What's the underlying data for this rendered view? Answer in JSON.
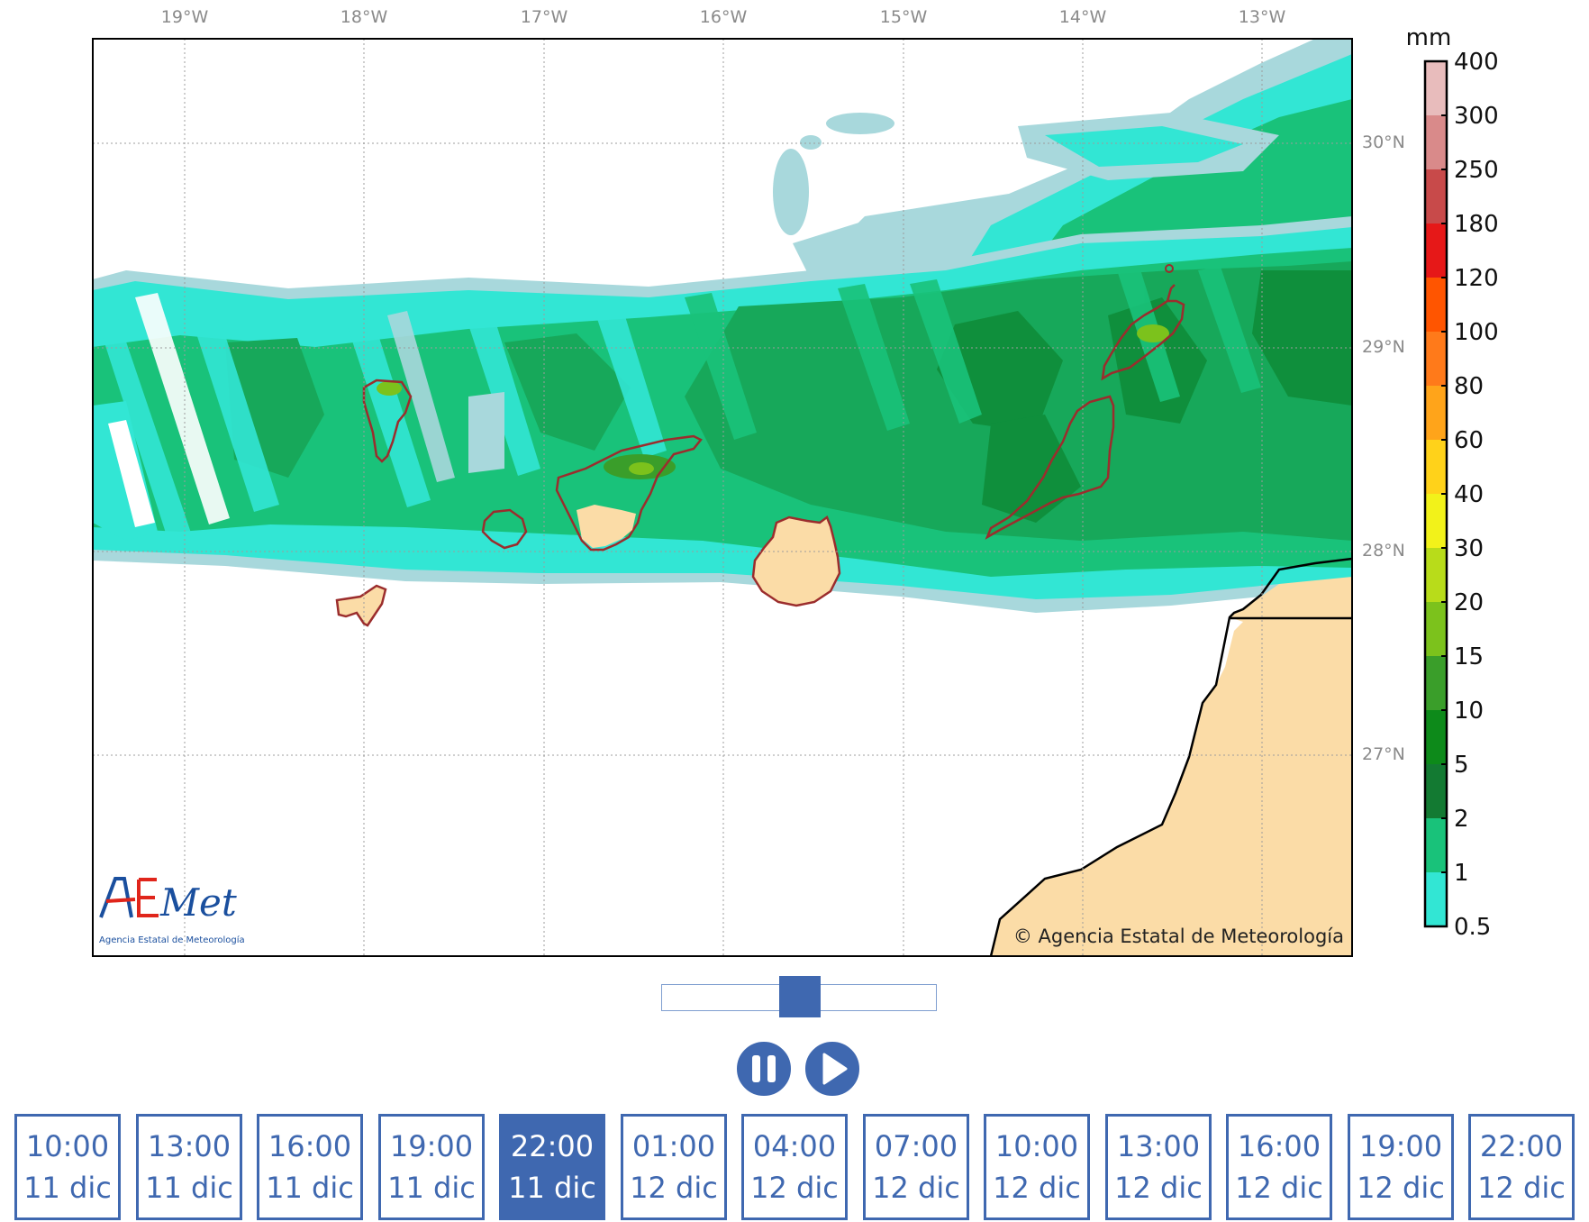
{
  "map": {
    "lon_labels": [
      "19°W",
      "18°W",
      "17°W",
      "16°W",
      "15°W",
      "14°W",
      "13°W"
    ],
    "lat_labels": [
      "30°N",
      "29°N",
      "28°N",
      "27°N"
    ],
    "credit": "© Agencia Estatal de Meteorología",
    "logo_text": "AEMet",
    "logo_subtitle": "Agencia Estatal de Meteorología",
    "colors": {
      "land": "#fbdca7",
      "island_outline": "#9b2d2d",
      "coast": "#000000",
      "precip_0_5": "#a8d8dc",
      "precip_1": "#32e6d4",
      "precip_2": "#19c27a",
      "precip_5": "#17a85a",
      "precip_10": "#0f8f3c"
    }
  },
  "colorbar": {
    "unit": "mm",
    "levels": [
      "400",
      "300",
      "250",
      "180",
      "120",
      "100",
      "80",
      "60",
      "40",
      "30",
      "20",
      "15",
      "10",
      "5",
      "2",
      "1",
      "0.5"
    ],
    "colors": [
      "#e8bcbc",
      "#d98a8a",
      "#c84a4a",
      "#e61818",
      "#ff5500",
      "#ff7a1a",
      "#ffa41a",
      "#ffd21a",
      "#f2f21a",
      "#b8dc1a",
      "#7cc21c",
      "#3a9e2a",
      "#0d8a1a",
      "#137a32",
      "#19c27a",
      "#32e6d4",
      "#a8d8dc"
    ]
  },
  "player": {
    "slider_value_fraction": 0.5,
    "pause_icon": "pause-icon",
    "play_icon": "play-icon"
  },
  "times": [
    {
      "time": "10:00",
      "day": "11 dic"
    },
    {
      "time": "13:00",
      "day": "11 dic"
    },
    {
      "time": "16:00",
      "day": "11 dic"
    },
    {
      "time": "19:00",
      "day": "11 dic"
    },
    {
      "time": "22:00",
      "day": "11 dic",
      "selected": true
    },
    {
      "time": "01:00",
      "day": "12 dic"
    },
    {
      "time": "04:00",
      "day": "12 dic"
    },
    {
      "time": "07:00",
      "day": "12 dic"
    },
    {
      "time": "10:00",
      "day": "12 dic"
    },
    {
      "time": "13:00",
      "day": "12 dic"
    },
    {
      "time": "16:00",
      "day": "12 dic"
    },
    {
      "time": "19:00",
      "day": "12 dic"
    },
    {
      "time": "22:00",
      "day": "12 dic"
    }
  ]
}
